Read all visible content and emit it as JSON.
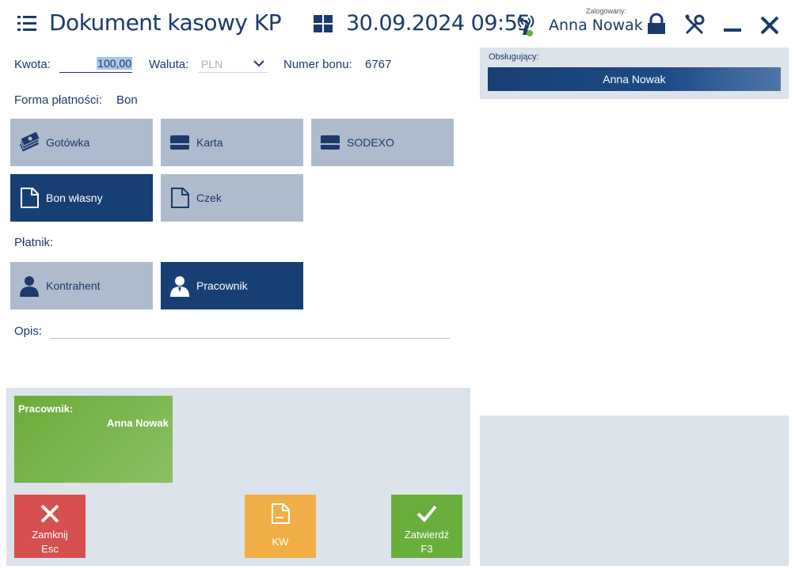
{
  "header": {
    "title": "Dokument kasowy KP",
    "datetime": "30.09.2024 09:55",
    "logged_label": "Zalogowany:",
    "logged_user": "Anna Nowak",
    "icons": [
      "menu-icon",
      "windows-grid-icon",
      "signal-icon",
      "lock-icon",
      "tools-icon",
      "minimize-icon",
      "close-icon"
    ]
  },
  "form": {
    "kwota_label": "Kwota:",
    "kwota_value": "100,00",
    "waluta_label": "Waluta:",
    "waluta_value": "PLN",
    "numer_bonu_label": "Numer bonu:",
    "numer_bonu_value": "6767",
    "forma_label": "Forma płatności:",
    "forma_value": "Bon",
    "payment_tiles": [
      {
        "label": "Gotówka",
        "icon": "cash-icon",
        "active": false
      },
      {
        "label": "Karta",
        "icon": "card-icon",
        "active": false
      },
      {
        "label": "SODEXO",
        "icon": "card-icon",
        "active": false
      },
      {
        "label": "Bon własny",
        "icon": "document-icon",
        "active": true
      },
      {
        "label": "Czek",
        "icon": "document-icon",
        "active": false
      }
    ],
    "platnik_label": "Płatnik:",
    "payer_tiles": [
      {
        "label": "Kontrahent",
        "icon": "person-icon",
        "active": false
      },
      {
        "label": "Pracownik",
        "icon": "employee-icon",
        "active": true
      }
    ],
    "opis_label": "Opis:",
    "opis_value": ""
  },
  "right_panel": {
    "obs_label": "Obsługujący:",
    "obs_value": "Anna Nowak"
  },
  "summary": {
    "card_key": "Pracownik:",
    "card_value": "Anna Nowak"
  },
  "actions": {
    "close_label": "Zamknij",
    "close_key": "Esc",
    "kw_label": "KW",
    "confirm_label": "Zatwierdź",
    "confirm_key": "F3"
  },
  "colors": {
    "primary": "#183f74",
    "tile": "#aebbcd",
    "panel": "#dde3eb",
    "close": "#d64f4f",
    "kw": "#f0ae47",
    "confirm": "#6aae3d"
  }
}
